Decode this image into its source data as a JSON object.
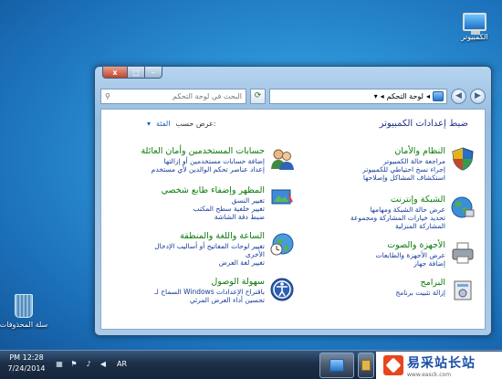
{
  "desktop": {
    "computer_icon_label": "الكمبيوتر",
    "recycle_bin_label": "سلة المحذوفات"
  },
  "window": {
    "controls": {
      "close": "x",
      "maximize": "□",
      "minimize": "–"
    },
    "search_placeholder": "البحث في لوحة التحكم",
    "address_text": "لوحة التحكم",
    "heading": "ضبط إعدادات الكمبيوتر",
    "view_by_label": "عرض حسب:",
    "view_by_value": "الفئة"
  },
  "categories": {
    "system": {
      "title": "النظام والأمان",
      "links": [
        "مراجعة حالة الكمبيوتر",
        "إجراء نسخ احتياطي للكمبيوتر",
        "استكشاف المشاكل وإصلاحها"
      ]
    },
    "network": {
      "title": "الشبكة وإنترنت",
      "links": [
        "عرض حالة الشبكة ومهامها",
        "تحديد خيارات المشاركة ومجموعة",
        "المشاركة المنزلية"
      ]
    },
    "hardware": {
      "title": "الأجهزة والصوت",
      "links": [
        "عرض الأجهزة والطابعات",
        "إضافة جهاز"
      ]
    },
    "programs": {
      "title": "البرامج",
      "links": [
        "إزالة تثبيت برنامج"
      ]
    },
    "users": {
      "title": "حسابات المستخدمين وأمان العائلة",
      "links": [
        "إضافة حسابات مستخدمين أو إزالتها",
        "إعداد عناصر تحكم الوالدين لأي مستخدم"
      ]
    },
    "appearance": {
      "title": "المظهر وإضفاء طابع شخصي",
      "links": [
        "تغيير النسق",
        "تغيير خلفية سطح المكتب",
        "ضبط دقة الشاشة"
      ]
    },
    "clock": {
      "title": "الساعة واللغة والمنطقة",
      "links": [
        "تغيير لوحات المفاتيح أو أساليب الإدخال",
        "الأخرى",
        "تغيير لغة العرض"
      ]
    },
    "access": {
      "title": "سهولة الوصول",
      "links": [
        "السماح لـ Windows باقتراح الإعدادات",
        "تحسين أداء العرض المرئي"
      ]
    }
  },
  "taskbar": {
    "time": "PM 12:28",
    "date": "7/24/2014",
    "language": "AR"
  },
  "watermark": {
    "name": "易采站长站",
    "url": "www.easck.com"
  }
}
